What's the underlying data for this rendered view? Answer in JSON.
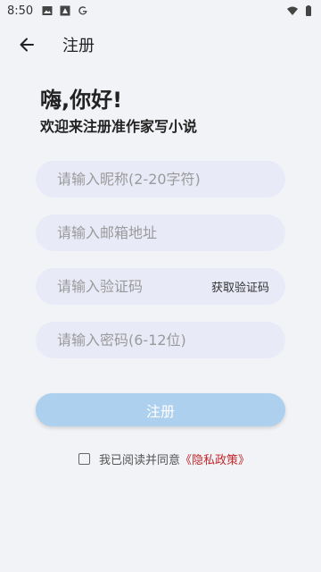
{
  "status_bar": {
    "time": "8:50",
    "left_icons": [
      "image-icon",
      "news-icon",
      "google-icon"
    ],
    "right_icons": [
      "wifi-icon",
      "battery-icon"
    ]
  },
  "app_bar": {
    "back_icon": "arrow-left-icon",
    "title": "注册"
  },
  "greeting": {
    "title": "嗨,你好!",
    "subtitle": "欢迎来注册准作家写小说"
  },
  "form": {
    "nickname_placeholder": "请输入昵称(2-20字符)",
    "email_placeholder": "请输入邮箱地址",
    "code_placeholder": "请输入验证码",
    "get_code_label": "获取验证码",
    "password_placeholder": "请输入密码(6-12位)"
  },
  "register_button": "注册",
  "agreement": {
    "text": "我已阅读并同意",
    "policy_link": "《隐私政策》",
    "checked": false
  },
  "colors": {
    "background": "#f2f3f7",
    "field_background": "#e9eaf8",
    "button_background": "#acd0ee",
    "link": "#c0292c"
  }
}
